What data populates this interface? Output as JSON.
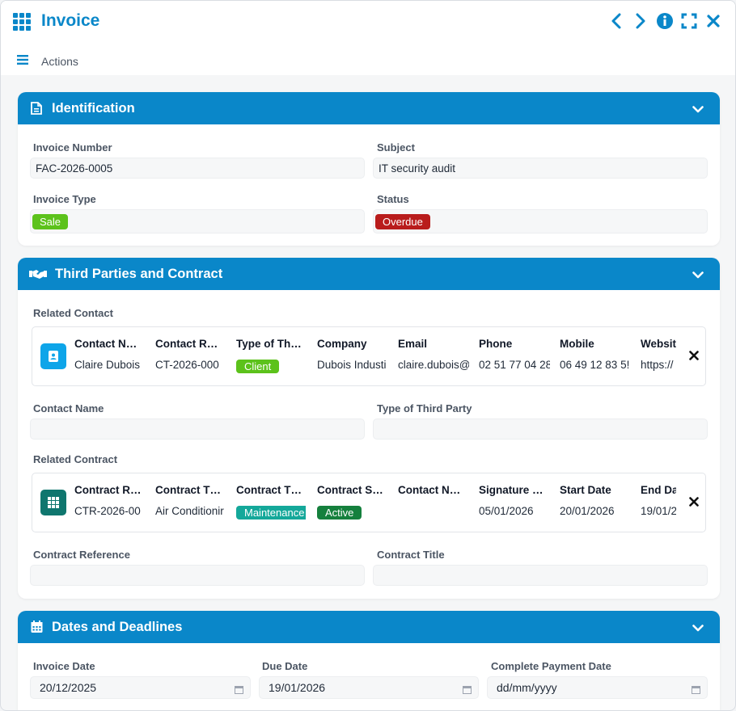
{
  "window": {
    "title": "Invoice",
    "controls": [
      "chevron-left-icon",
      "chevron-right-icon",
      "info-icon",
      "fullscreen-icon",
      "close-icon"
    ]
  },
  "toolbar": {
    "actions_label": "Actions"
  },
  "colors": {
    "accent": "#0a87c9",
    "sale": "#5cc21b",
    "overdue": "#b91c1c",
    "client": "#5cc21b",
    "maintenance": "#14a89a",
    "active": "#15803d",
    "contact_badge": "#0ea5e9",
    "contract_badge": "#0f766e"
  },
  "identification": {
    "title": "Identification",
    "invoice_number": {
      "label": "Invoice Number",
      "value": "FAC-2026-0005"
    },
    "subject": {
      "label": "Subject",
      "value": "IT security audit"
    },
    "invoice_type": {
      "label": "Invoice Type",
      "value": "Sale"
    },
    "status": {
      "label": "Status",
      "value": "Overdue"
    }
  },
  "third_parties": {
    "title": "Third Parties and Contract",
    "related_contact": {
      "label": "Related Contact",
      "headers": [
        "Contact N…",
        "Contact R…",
        "Type of Th…",
        "Company",
        "Email",
        "Phone",
        "Mobile",
        "Websit"
      ],
      "values": [
        "Claire Dubois",
        "CT-2026-000",
        "Client",
        "Dubois Industi",
        "claire.dubois@",
        "02 51 77 04 28",
        "06 49 12 83 5!",
        "https://"
      ]
    },
    "contact_name": {
      "label": "Contact Name",
      "value": ""
    },
    "type_of_third_party": {
      "label": "Type of Third Party",
      "value": ""
    },
    "related_contract": {
      "label": "Related Contract",
      "headers": [
        "Contract R…",
        "Contract T…",
        "Contract T…",
        "Contract S…",
        "Contact N…",
        "Signature …",
        "Start Date",
        "End Da"
      ],
      "values": [
        "CTR-2026-00",
        "Air Conditionir",
        "Maintenance",
        "Active",
        "",
        "05/01/2026",
        "20/01/2026",
        "19/01/2"
      ]
    },
    "contract_reference": {
      "label": "Contract Reference",
      "value": ""
    },
    "contract_title": {
      "label": "Contract Title",
      "value": ""
    }
  },
  "dates": {
    "title": "Dates and Deadlines",
    "invoice_date": {
      "label": "Invoice Date",
      "value": "20/12/2025"
    },
    "due_date": {
      "label": "Due Date",
      "value": "19/01/2026"
    },
    "complete_payment_date": {
      "label": "Complete Payment Date",
      "value": "dd/mm/yyyy"
    }
  }
}
